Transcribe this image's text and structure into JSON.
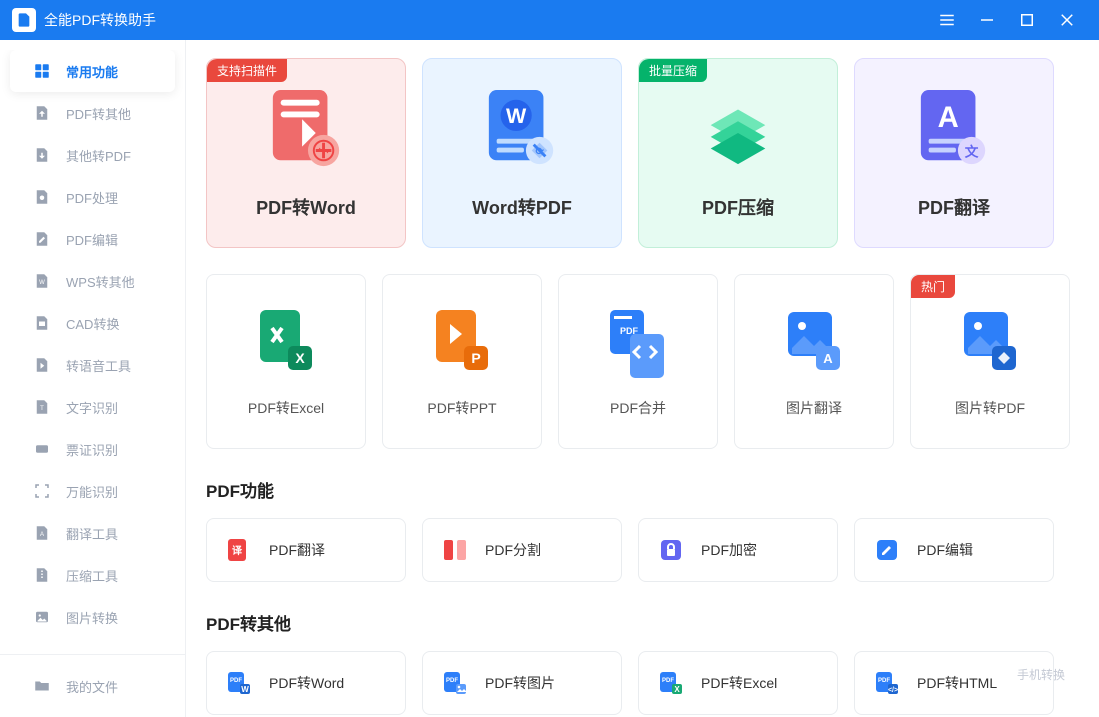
{
  "app": {
    "title": "全能PDF转换助手"
  },
  "titlebar": {
    "menu": "≡",
    "min": "—",
    "max": "□",
    "close": "✕"
  },
  "sidebar": {
    "items": [
      {
        "label": "常用功能",
        "icon": "grid",
        "active": true
      },
      {
        "label": "PDF转其他",
        "icon": "export",
        "active": false
      },
      {
        "label": "其他转PDF",
        "icon": "import",
        "active": false
      },
      {
        "label": "PDF处理",
        "icon": "tools",
        "active": false
      },
      {
        "label": "PDF编辑",
        "icon": "edit",
        "active": false
      },
      {
        "label": "WPS转其他",
        "icon": "wps",
        "active": false
      },
      {
        "label": "CAD转换",
        "icon": "cad",
        "active": false
      },
      {
        "label": "转语音工具",
        "icon": "audio",
        "active": false
      },
      {
        "label": "文字识别",
        "icon": "ocr",
        "active": false
      },
      {
        "label": "票证识别",
        "icon": "ticket",
        "active": false
      },
      {
        "label": "万能识别",
        "icon": "scan",
        "active": false
      },
      {
        "label": "翻译工具",
        "icon": "translate",
        "active": false
      },
      {
        "label": "压缩工具",
        "icon": "zip",
        "active": false
      },
      {
        "label": "图片转换",
        "icon": "image",
        "active": false
      }
    ],
    "footer": {
      "label": "我的文件",
      "icon": "folder"
    }
  },
  "featured": [
    {
      "label": "PDF转Word",
      "badge": "支持扫描件",
      "badgeColor": "red",
      "theme": "red"
    },
    {
      "label": "Word转PDF",
      "badge": "",
      "badgeColor": "",
      "theme": "blue"
    },
    {
      "label": "PDF压缩",
      "badge": "批量压缩",
      "badgeColor": "green",
      "theme": "green"
    },
    {
      "label": "PDF翻译",
      "badge": "",
      "badgeColor": "",
      "theme": "violet"
    }
  ],
  "smallCards": [
    {
      "label": "PDF转Excel",
      "color": "#19a974",
      "badge": ""
    },
    {
      "label": "PDF转PPT",
      "color": "#f58220",
      "badge": ""
    },
    {
      "label": "PDF合并",
      "color": "#2d7ff9",
      "badge": ""
    },
    {
      "label": "图片翻译",
      "color": "#2d7ff9",
      "badge": ""
    },
    {
      "label": "图片转PDF",
      "color": "#2d7ff9",
      "badge": "热门"
    }
  ],
  "sections": [
    {
      "title": "PDF功能",
      "items": [
        {
          "label": "PDF翻译",
          "color": "#ef4444"
        },
        {
          "label": "PDF分割",
          "color": "#ef4444"
        },
        {
          "label": "PDF加密",
          "color": "#6366f1"
        },
        {
          "label": "PDF编辑",
          "color": "#2d7ff9"
        }
      ]
    },
    {
      "title": "PDF转其他",
      "items": [
        {
          "label": "PDF转Word",
          "color": "#2d7ff9"
        },
        {
          "label": "PDF转图片",
          "color": "#2d7ff9"
        },
        {
          "label": "PDF转Excel",
          "color": "#19a974"
        },
        {
          "label": "PDF转HTML",
          "color": "#2d7ff9"
        }
      ]
    }
  ],
  "floating": {
    "label": "手机转换"
  }
}
